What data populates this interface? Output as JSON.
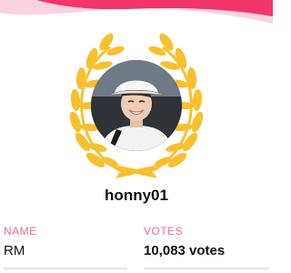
{
  "profile": {
    "username": "honny01",
    "avatar_icon": "user-photo"
  },
  "info": {
    "name_label": "NAME",
    "name_value": "RM",
    "votes_label": "VOTES",
    "votes_value": "10,083 votes"
  },
  "colors": {
    "header_pink": "#f2356b",
    "header_light": "#fbd3df",
    "wreath_gold": "#f7c02e",
    "label_pink": "#f06a9a"
  }
}
